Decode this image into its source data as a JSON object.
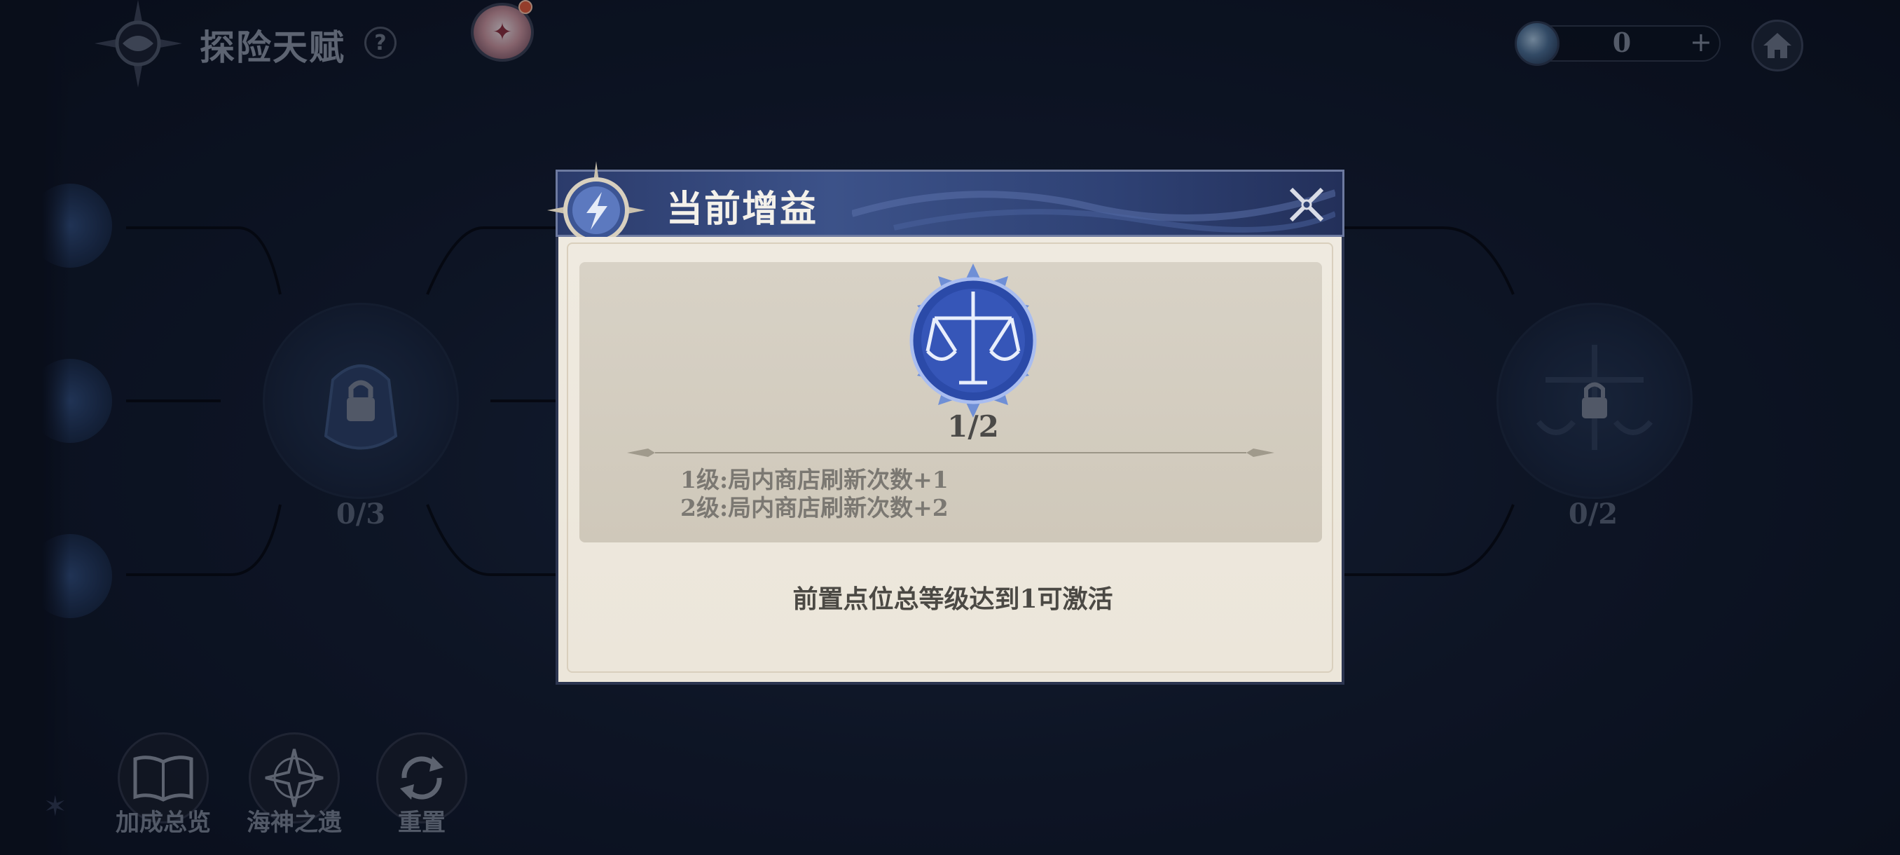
{
  "header": {
    "title": "探险天赋",
    "help_label": "?",
    "currency_value": "0",
    "currency_add": "+"
  },
  "talent_nodes": [
    {
      "progress": "0/3"
    },
    {
      "progress": "0/2"
    }
  ],
  "bottom_bar": {
    "items": [
      {
        "label": "加成总览",
        "icon": "book-icon"
      },
      {
        "label": "海神之遗",
        "icon": "compass-star-icon"
      },
      {
        "label": "重置",
        "icon": "reset-cycle-icon"
      }
    ]
  },
  "modal": {
    "title": "当前增益",
    "level": "1/2",
    "effects": [
      "1级:局内商店刷新次数+1",
      "2级:局内商店刷新次数+2"
    ],
    "requirement": "前置点位总等级达到1可激活",
    "icon": "balance-scale-icon"
  },
  "colors": {
    "modal_header": "#3c5289",
    "modal_body": "#efeae0",
    "page_background": "#121c30"
  }
}
